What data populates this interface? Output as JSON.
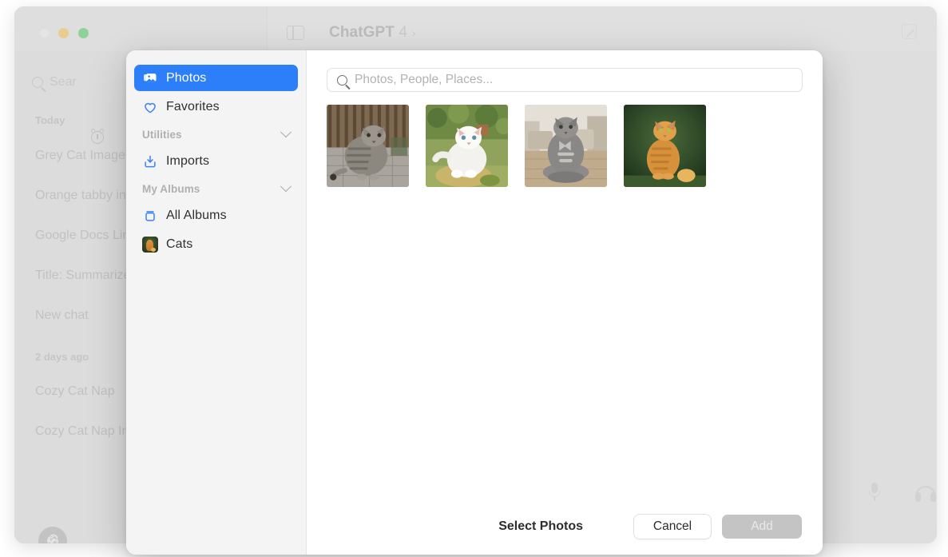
{
  "background_window": {
    "title": "ChatGPT",
    "title_version": "4",
    "title_chevron": "›",
    "traffic_lights": [
      "close",
      "minimize",
      "maximize"
    ],
    "sidebar_toggle_icon": "sidebar-toggle-icon",
    "compose_icon": "compose-icon",
    "search": {
      "placeholder": "Sear"
    },
    "alarm_icon": "alarm-clock-icon",
    "sections": [
      {
        "label": "Today",
        "items": [
          "Grey Cat Image",
          "Orange tabby in",
          "Google Docs Lin",
          "Title: Summarize",
          "New chat"
        ]
      },
      {
        "label": "2 days ago",
        "items": [
          "Cozy Cat Nap",
          "Cozy Cat Nap In"
        ]
      }
    ],
    "account_logo": "openai-logo",
    "mic_icon": "microphone-icon",
    "headphones_icon": "headphones-icon"
  },
  "dialog": {
    "sidebar": {
      "items": [
        {
          "label": "Photos",
          "icon": "photos-icon",
          "selected": true
        },
        {
          "label": "Favorites",
          "icon": "heart-icon",
          "selected": false
        }
      ],
      "groups": [
        {
          "label": "Utilities",
          "items": [
            {
              "label": "Imports",
              "icon": "import-icon"
            }
          ]
        },
        {
          "label": "My Albums",
          "items": [
            {
              "label": "All Albums",
              "icon": "albums-icon"
            },
            {
              "label": "Cats",
              "icon": "album-thumbnail"
            }
          ]
        }
      ]
    },
    "search": {
      "placeholder": "Photos, People, Places...",
      "value": ""
    },
    "photos": [
      {
        "alt": "grey tabby cat sitting on deck by fence"
      },
      {
        "alt": "white fluffy cat sitting in garden"
      },
      {
        "alt": "grey cat sitting indoors on rug"
      },
      {
        "alt": "orange tabby cat on green background"
      }
    ],
    "footer": {
      "label": "Select Photos",
      "cancel_label": "Cancel",
      "add_label": "Add"
    }
  },
  "colors": {
    "accent_blue": "#2d7ff9",
    "icon_blue": "#3b82f6",
    "dialog_sidebar_bg": "#f4f4f4",
    "dialog_bg": "#ffffff",
    "dimmed_window_bg": "#dcdcdc"
  }
}
